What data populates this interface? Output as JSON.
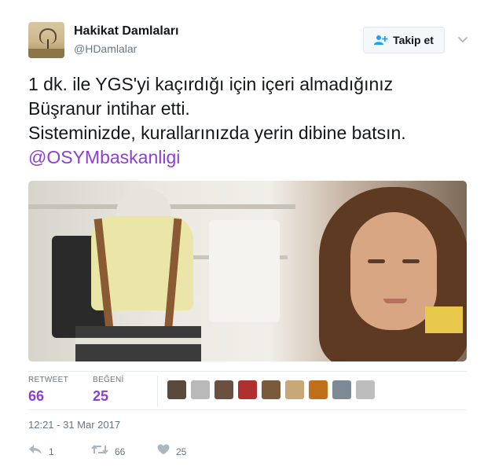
{
  "author": {
    "name": "Hakikat Damlaları",
    "handle": "@HDamlalar",
    "avatar_icon": "profile-photo-tree-landscape"
  },
  "follow_button": {
    "label": "Takip et",
    "icon": "add-user-icon"
  },
  "more_menu_icon": "chevron-down-icon",
  "tweet": {
    "lines": [
      "1 dk. ile YGS'yi kaçırdığı için içeri almadığınız",
      "Büşranur intihar etti.",
      "Sisteminizde, kurallarınızda yerin dibine batsın."
    ],
    "mention": "@OSYMbaskanligi"
  },
  "photo": {
    "icon": "tweet-photo"
  },
  "stats": {
    "retweet_label": "RETWEET",
    "retweet_count": "66",
    "like_label": "BEĞENİ",
    "like_count": "25"
  },
  "liker_avatars": [
    {
      "color": "#5a4a3c"
    },
    {
      "color": "#b9b9b9"
    },
    {
      "color": "#6a5040"
    },
    {
      "color": "#b03030"
    },
    {
      "color": "#7a5a3a"
    },
    {
      "color": "#c8a878"
    },
    {
      "color": "#c07018"
    },
    {
      "color": "#7d8a96"
    },
    {
      "color": "#bdbdbd"
    }
  ],
  "timestamp": "12:21 - 31 Mar 2017",
  "actions": {
    "reply_count": "1",
    "retweet_count": "66",
    "like_count": "25"
  },
  "colors": {
    "accent": "#8c3fd6",
    "secondary_text": "#657786",
    "action_icon": "#aab8c2"
  }
}
